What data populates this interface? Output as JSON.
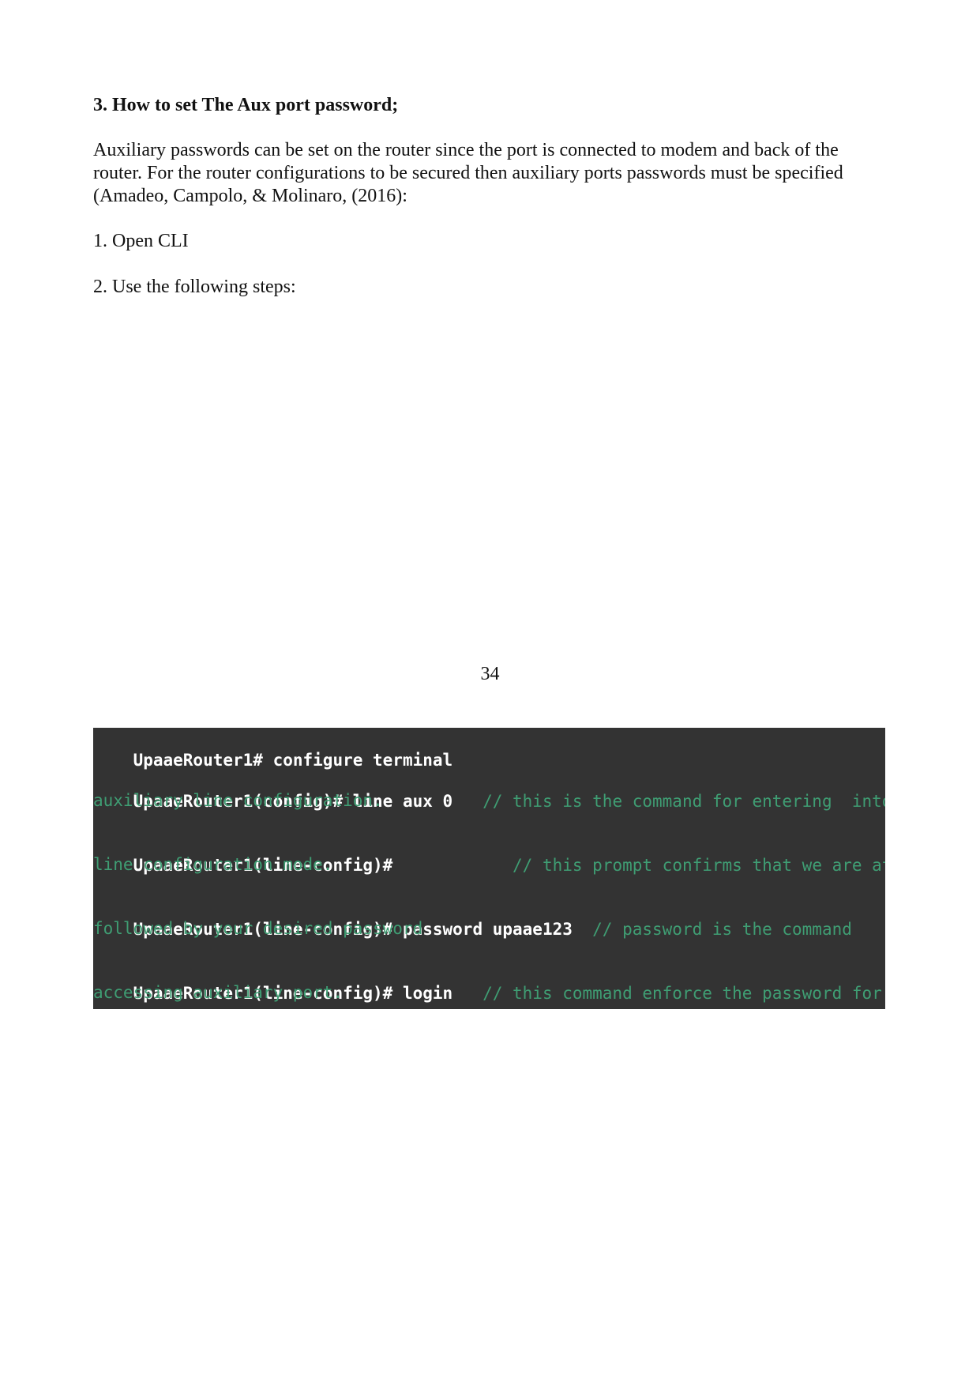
{
  "heading": "3. How to set The Aux port password;",
  "paragraph": "Auxiliary passwords can be set on the router since the port is connected to modem and back of the router. For the router configurations to be secured then auxiliary ports passwords must be specified (Amadeo, Campolo, & Molinaro,  (2016):",
  "steps": [
    "1. Open  CLI",
    "2. Use the following steps:"
  ],
  "page_number": "34",
  "terminal": {
    "colors": {
      "background": "#333333",
      "command": "#ffffff",
      "comment": "#3f9d73"
    },
    "lines": [
      {
        "command": "UpaaeRouter1# configure terminal",
        "comment": "",
        "comment_cont": ""
      },
      {
        "command": "UpaaeRouter1(config)# line aux 0",
        "comment": "   // this is the command for entering  into",
        "comment_cont": "auxiliary line configuration."
      },
      {
        "command": "UpaaeRouter1(line-config)#",
        "comment": "            // this prompt confirms that we are at",
        "comment_cont": "line configuration mode."
      },
      {
        "command": "UpaaeRouter1(line-config)# password upaae123",
        "comment": "  // password is the command",
        "comment_cont": "followed by your desired password"
      },
      {
        "command": "UpaaeRouter1(line-config)# login",
        "comment": "   // this command enforce the password for",
        "comment_cont": "accessing auxiliary port."
      }
    ]
  }
}
